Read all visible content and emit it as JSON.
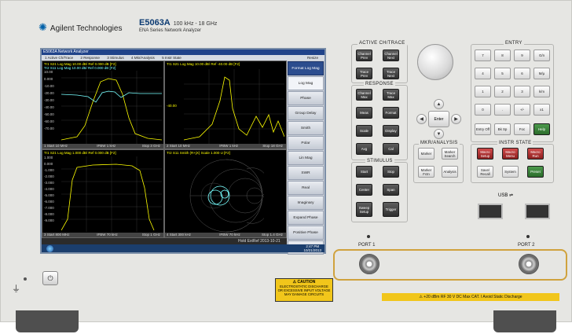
{
  "brand": {
    "company": "Agilent Technologies",
    "model": "E5063A",
    "range": "100 kHz - 18 GHz",
    "series": "ENA Series Network Analyzer"
  },
  "app": {
    "title": "E5063A Network Analyzer",
    "menus": [
      "1 Active Ch/Trace",
      "2 Response",
      "3 Stimulus",
      "4 Mkr/Analysis",
      "5 Instr State"
    ],
    "resize": "Resize"
  },
  "channels": [
    {
      "trace1": "Tr1 S21 Log Mag 10.00 dB/ Ref 0.000 dB [F2]",
      "trace2": "Tr2 S11 Log Mag 10.00 dB/ Ref 0.000 dB [F2]",
      "axis": [
        "10.00",
        "0.000",
        "-10.00",
        "-20.00",
        "-30.00",
        "-40.00",
        "-50.00",
        "-60.00",
        "-70.00",
        "-80.00"
      ],
      "start": "1 Start 10 MHz",
      "ifbw": "IFBW 1 kHz",
      "stop": "Stop 3 GHz",
      "cor": "Cor"
    },
    {
      "trace1": "Tr1 S21 Log Mag 10.00 dB/ Ref -40.00 dB [F2]",
      "axis": [
        "-40.00"
      ],
      "start": "2 Start 10 MHz",
      "ifbw": "IFBW 1 kHz",
      "stop": "Stop 18 GHz",
      "cor": "Cor"
    },
    {
      "trace1": "Tr1 S21 Log Mag 1.000 dB/ Ref 0.000 dB [F2]",
      "axis": [
        "1.000",
        "0.000",
        "-1.000",
        "-2.000",
        "-3.000",
        "-4.000",
        "-5.000",
        "-6.000",
        "-7.000",
        "-8.000",
        "-9.000"
      ],
      "start": "3 Start 800 MHz",
      "ifbw": "IFBW 70 kHz",
      "stop": "Stop 1 GHz",
      "cor": "Cor"
    },
    {
      "trace1": "Tr2 S11 Smith (R+jX) Scale 1.000 U [F2]",
      "start": "4 Start 300 kHz",
      "ifbw": "IFBW 70 kHz",
      "stop": "Stop 1.4 GHz",
      "cor": "Cor"
    }
  ],
  "softkeys": [
    "Format Log Mag",
    "Log Mag",
    "Phase",
    "Group Delay",
    "Smith",
    "Polar",
    "Lin Mag",
    "SWR",
    "Real",
    "Imaginary",
    "Expand Phase",
    "Positive Phase",
    "Return"
  ],
  "status": {
    "hold": "Hold",
    "extref": "ExtRef",
    "datetime": "2013-10-21 14:47"
  },
  "taskbar": {
    "time": "2:47 PM",
    "date": "10/21/2013"
  },
  "panel": {
    "active": {
      "label": "ACTIVE CH/TRACE",
      "keys": [
        "Channel Prev",
        "Channel Next",
        "Trace Prev",
        "Trace Next"
      ]
    },
    "response": {
      "label": "RESPONSE",
      "keys": [
        "Channel Max",
        "Trace Max",
        "Meas",
        "Format",
        "Scale",
        "Display",
        "Avg",
        "Cal"
      ]
    },
    "stimulus": {
      "label": "STIMULUS",
      "keys": [
        "Start",
        "Stop",
        "Center",
        "Span",
        "Sweep Setup",
        "Trigger"
      ]
    },
    "mkr": {
      "label": "MKR/ANALYSIS",
      "keys": [
        "Marker",
        "Marker Search",
        "Marker Fctn",
        "Analysis"
      ]
    },
    "entry": {
      "label": "ENTRY",
      "keys": [
        "7",
        "8",
        "9",
        "G/n",
        "4",
        "5",
        "6",
        "M/μ",
        "1",
        "2",
        "3",
        "k/m",
        "0",
        ".",
        "+/-",
        "x1",
        "Entry Off",
        "Bk Sp",
        "Foc",
        "Help"
      ]
    },
    "instr": {
      "label": "INSTR STATE",
      "keys": [
        "Macro Setup",
        "Macro Menu",
        "Macro Run",
        "Save/ Recall",
        "System",
        "Preset"
      ]
    },
    "nav": {
      "enter": "Enter",
      "up": "▲",
      "down": "▼",
      "left": "◀",
      "right": "▶"
    },
    "usb": "USB",
    "port1": "PORT 1",
    "port2": "PORT 2",
    "caution": {
      "title": "⚠ CAUTION",
      "l1": "ELECTROSTATIC DISCHARGE",
      "l2": "OR EXCESSIVE INPUT VOLTAGE",
      "l3": "MAY DAMAGE CIRCUITS"
    },
    "rating": "⚠ +20 dBm RF   30 V DC   Max     CAT. I    Avoid Static Discharge",
    "power": "⏻"
  }
}
